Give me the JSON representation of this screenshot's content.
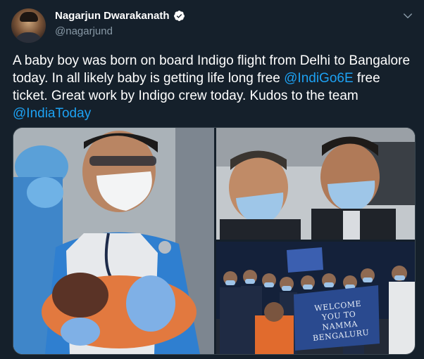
{
  "author": {
    "name": "Nagarjun Dwarakanath",
    "handle": "@nagarjund"
  },
  "tweet": {
    "text_1": "A baby boy was born on board Indigo flight from Delhi to Bangalore today. In all likely baby is getting life long free ",
    "mention_1": "@IndiGo6E",
    "text_2": " free ticket. Great work by Indigo crew today. Kudos to the team ",
    "mention_2": "@IndiaToday"
  },
  "media": {
    "banner_line_1": "WELCOME",
    "banner_line_2": "YOU TO",
    "banner_line_3": "NAMMA",
    "banner_line_4": "BENGALURU"
  },
  "icons": {
    "verified": "verified-badge-icon",
    "chevron": "chevron-down-icon"
  },
  "colors": {
    "background": "#15202b",
    "link": "#1da1f2",
    "secondary_text": "#8899a6"
  }
}
